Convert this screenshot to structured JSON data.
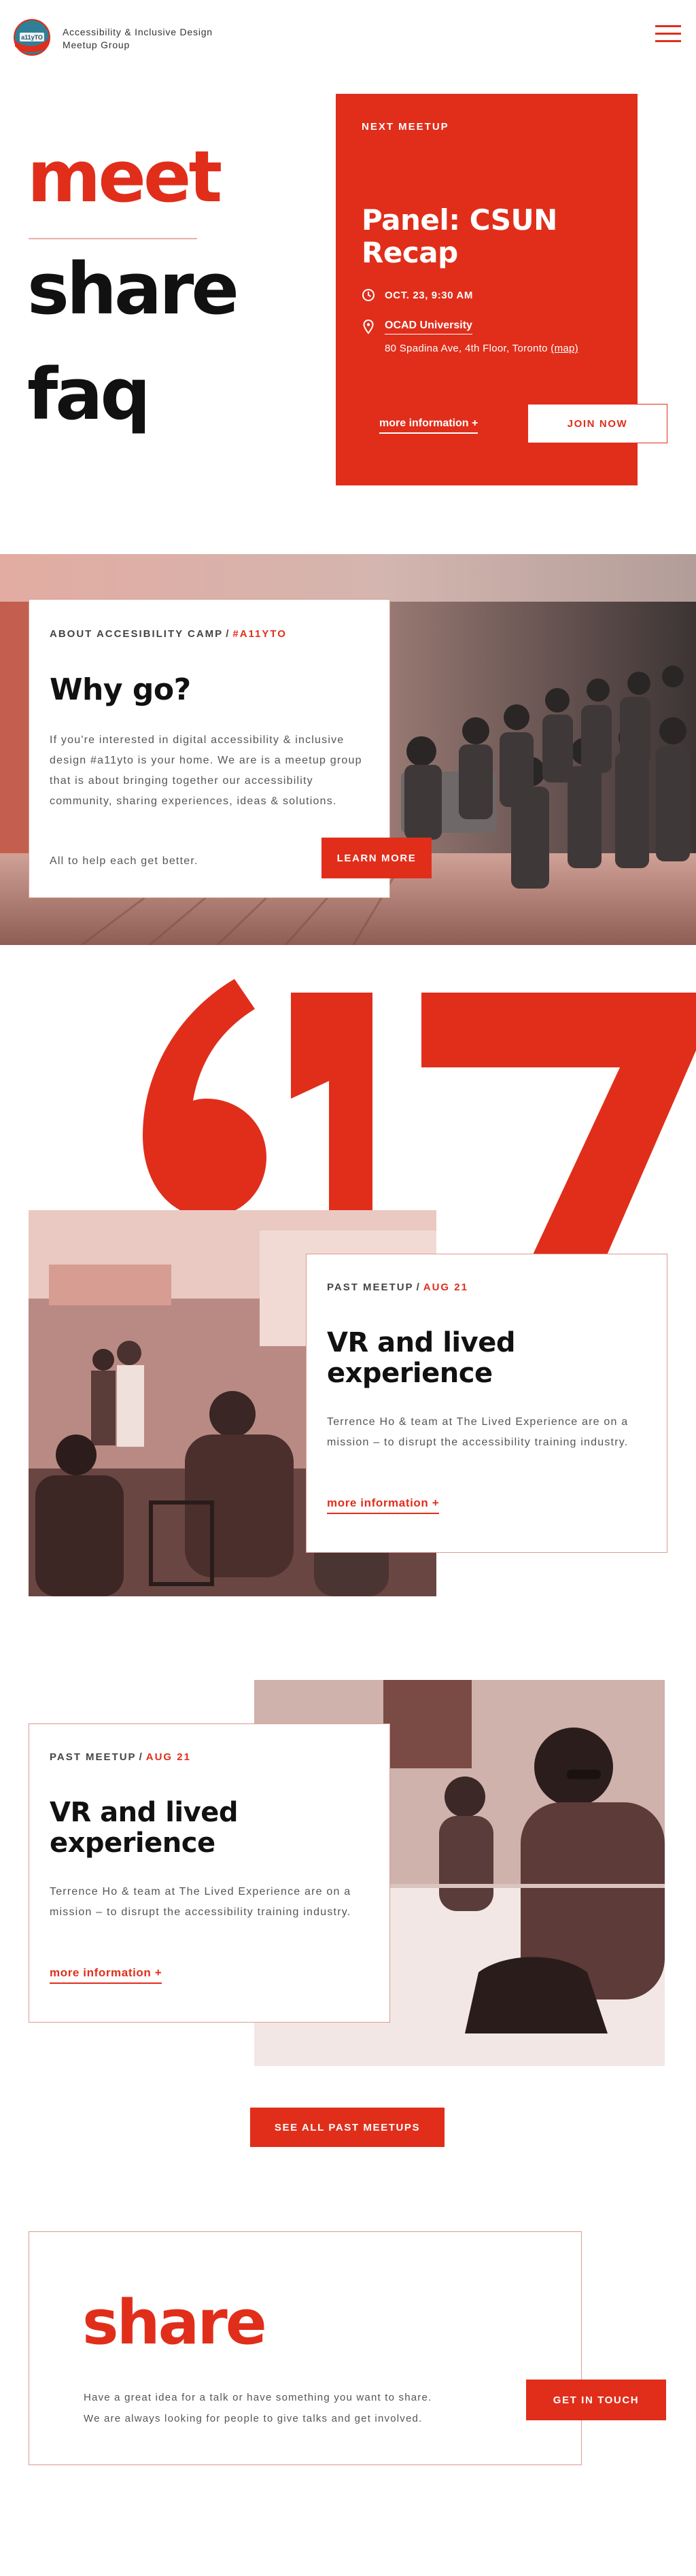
{
  "header": {
    "logo_badge_text": "a11yTO",
    "site_title_line1": "Accessibility & Inclusive Design",
    "site_title_line2": "Meetup Group",
    "menu_icon": "hamburger-menu-icon"
  },
  "hero": {
    "words": [
      "meet",
      "share",
      "faq"
    ],
    "next_meetup": {
      "eyebrow": "NEXT MEETUP",
      "title_line1": "Panel: CSUN",
      "title_line2": "Recap",
      "datetime_icon": "clock-icon",
      "datetime": "OCT. 23, 9:30 AM",
      "location_icon": "map-pin-icon",
      "venue": "OCAD University",
      "address": "80 Spadina Ave, 4th Floor, Toronto",
      "map_link": "(map)",
      "more_info": "more information +",
      "join": "JOIN NOW"
    }
  },
  "about": {
    "eyebrow": "ABOUT ACCESIBILITY CAMP",
    "eyebrow_sep": "/",
    "eyebrow_tag": "#A11YTO",
    "title": "Why go?",
    "body": "If you're interested in digital accessibility & inclusive design #a11yto is your home. We are is a meetup group that is about bringing together our accessibility community, sharing experiences, ideas & solutions.",
    "body2": "All to help each get better.",
    "button": "LEARN MORE"
  },
  "past_meetups": [
    {
      "eyebrow": "PAST MEETUP",
      "sep": "/",
      "date": "AUG 21",
      "title_line1": "VR and lived",
      "title_line2": "experience",
      "body": "Terrence Ho & team at The Lived Experience are on a mission – to disrupt the accessibility training industry.",
      "more_info": "more information +"
    },
    {
      "eyebrow": "PAST MEETUP",
      "sep": "/",
      "date": "AUG 21",
      "title_line1": "VR and lived",
      "title_line2": "experience",
      "body": "Terrence Ho & team at The Lived Experience are on a mission – to disrupt the accessibility training industry.",
      "more_info": "more information +"
    }
  ],
  "see_all_button": "SEE ALL PAST MEETUPS",
  "share": {
    "title": "share",
    "body_line1": "Have a great idea for a talk or have something you want to share.",
    "body_line2": "We are always looking for people to give talks and get involved.",
    "button": "GET IN TOUCH"
  },
  "colors": {
    "accent": "#e02e1b",
    "text": "#111111",
    "muted": "#555555",
    "card_border": "#d99b93"
  }
}
